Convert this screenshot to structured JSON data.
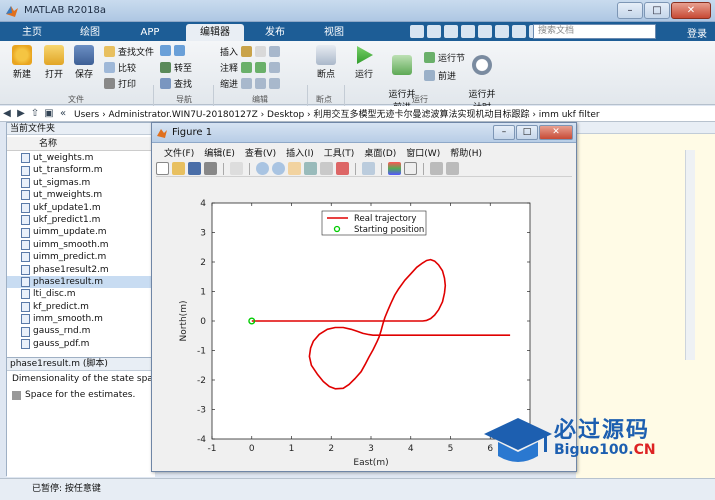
{
  "app": {
    "title": "MATLAB R2018a"
  },
  "tabs": [
    {
      "label": "主页"
    },
    {
      "label": "绘图"
    },
    {
      "label": "APP"
    },
    {
      "label": "编辑器"
    },
    {
      "label": "发布"
    },
    {
      "label": "视图"
    }
  ],
  "search": {
    "placeholder": "搜索文档"
  },
  "login": "登录",
  "ribbon": {
    "file_group": "文件",
    "nav_group": "导航",
    "edit_group": "编辑",
    "breakpoints_group": "断点",
    "run_group": "运行",
    "new": "新建",
    "open": "打开",
    "save": "保存",
    "find_files": "查找文件",
    "compare": "比较",
    "print": "打印",
    "goto": "转至",
    "find": "查找",
    "insert": "插入",
    "comment": "注释",
    "indent": "缩进",
    "breakpoints": "断点",
    "run": "运行",
    "run_advance": "运行并\n前进",
    "run_section": "运行节",
    "advance": "前进",
    "run_time": "运行并\n计时"
  },
  "address": {
    "path": "Users  ›  Administrator.WIN7U-20180127Z  ›  Desktop  ›  利用交互多模型无迹卡尔曼滤波算法实现机动目标跟踪  ›  imm ukf filter"
  },
  "left_panel": {
    "title": "当前文件夹",
    "col_name": "名称",
    "files": [
      "ut_weights.m",
      "ut_transform.m",
      "ut_sigmas.m",
      "ut_mweights.m",
      "ukf_update1.m",
      "ukf_predict1.m",
      "uimm_update.m",
      "uimm_smooth.m",
      "uimm_predict.m",
      "phase1result2.m",
      "phase1result.m",
      "lti_disc.m",
      "kf_predict.m",
      "imm_smooth.m",
      "gauss_rnd.m",
      "gauss_pdf.m"
    ],
    "selected_index": 10,
    "details_title": "phase1result.m  (脚本)",
    "detail_line1": "Dimensionality of the state space",
    "detail_line2": "Space for the estimates."
  },
  "status": {
    "text": "已暂停: 按任意键"
  },
  "figure": {
    "title": "Figure 1",
    "menu": [
      "文件(F)",
      "编辑(E)",
      "查看(V)",
      "插入(I)",
      "工具(T)",
      "桌面(D)",
      "窗口(W)",
      "帮助(H)"
    ]
  },
  "chart_data": {
    "type": "line",
    "xlabel": "East(m)",
    "ylabel": "North(m)",
    "xlim": [
      -1,
      7
    ],
    "ylim": [
      -4,
      4
    ],
    "xticks": [
      -1,
      0,
      1,
      2,
      3,
      4,
      5,
      6
    ],
    "yticks": [
      -4,
      -3,
      -2,
      -1,
      0,
      1,
      2,
      3,
      4
    ],
    "grid": false,
    "legend_position": "top-center",
    "series": [
      {
        "name": "Real trajectory",
        "color": "#e00000",
        "x": [
          0,
          0.5,
          1,
          1.5,
          2,
          2.5,
          3,
          3.15,
          3.3,
          3.45,
          3.6,
          3.75,
          3.9,
          4.05,
          4.2,
          4.3,
          4.4,
          4.5,
          4.6,
          4.7,
          4.8,
          4.85,
          4.87,
          4.85,
          4.8,
          4.7,
          4.6,
          4.5,
          4.4,
          4.3,
          4.15,
          4.0,
          3.85,
          3.7,
          3.6,
          3.5,
          3.42,
          3.35,
          3.3,
          3.25,
          3.2,
          3.15,
          3.05,
          2.95,
          2.85,
          2.75,
          2.6,
          2.45,
          2.3,
          2.1,
          1.95,
          1.8,
          1.65,
          1.5,
          1.45,
          1.48,
          1.55,
          1.7,
          1.9,
          2.1,
          2.3,
          2.5,
          2.65,
          2.8,
          2.95,
          3.05,
          3.15,
          3.25,
          3.35,
          3.45,
          3.55,
          3.65,
          3.75,
          3.9,
          4.1,
          4.5,
          5.0,
          5.5,
          6.0,
          6.5
        ],
        "y": [
          0,
          0,
          0,
          0,
          0,
          0,
          0,
          0,
          0,
          0,
          0,
          0,
          0,
          0,
          0,
          0,
          0.02,
          0.08,
          0.2,
          0.38,
          0.65,
          0.95,
          1.2,
          1.45,
          1.7,
          1.9,
          2.03,
          2.08,
          2.05,
          1.97,
          1.82,
          1.6,
          1.38,
          1.1,
          0.88,
          0.6,
          0.35,
          0.12,
          -0.1,
          -0.35,
          -0.55,
          -0.7,
          -0.98,
          -1.22,
          -1.48,
          -1.72,
          -1.95,
          -2.15,
          -2.28,
          -2.3,
          -2.22,
          -2.05,
          -1.8,
          -1.5,
          -1.2,
          -0.92,
          -0.68,
          -0.45,
          -0.28,
          -0.22,
          -0.22,
          -0.28,
          -0.35,
          -0.42,
          -0.46,
          -0.48,
          -0.48,
          -0.48,
          -0.48,
          -0.48,
          -0.48,
          -0.48,
          -0.48,
          -0.48,
          -0.48,
          -0.48,
          -0.48,
          -0.48,
          -0.48,
          -0.48
        ]
      },
      {
        "name": "Starting position",
        "color": "#00cc00",
        "marker": "circle",
        "x": [
          0
        ],
        "y": [
          0
        ]
      }
    ]
  },
  "watermark": {
    "main": "必过源码",
    "sub_prefix": "Biguo100.",
    "sub_suffix": "CN"
  }
}
